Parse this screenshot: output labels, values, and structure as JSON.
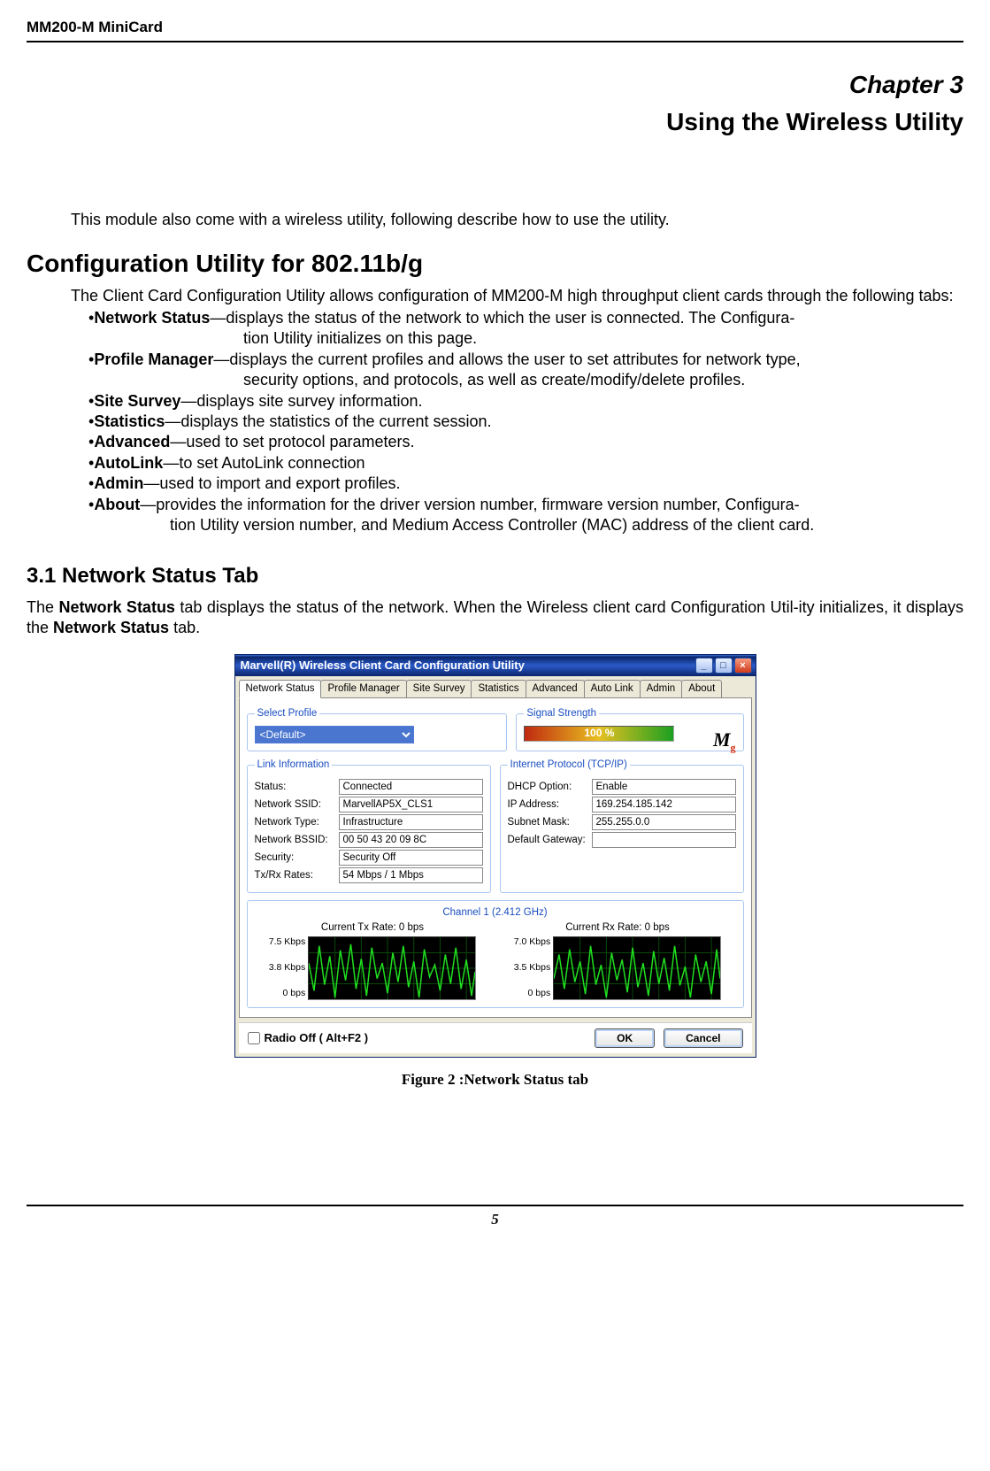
{
  "header": {
    "title": "MM200-M MiniCard"
  },
  "chapter": {
    "label": "Chapter 3",
    "subtitle": "Using the Wireless Utility"
  },
  "intro": "This module also come with a wireless utility, following describe how to use the utility.",
  "config": {
    "heading": "Configuration Utility for 802.11b/g",
    "lead": "The Client Card Configuration Utility allows configuration of MM200-M high throughput client cards through the following tabs:",
    "items": [
      {
        "name": "Network Status",
        "desc": "—displays the status of the network to which the user is connected. The Configura-",
        "wrap": "tion Utility initializes on this page."
      },
      {
        "name": "Profile Manager",
        "desc": "—displays the current profiles and allows the user to set attributes for network type,",
        "wrap": "security options, and protocols, as well as create/modify/delete profiles."
      },
      {
        "name": "Site Survey",
        "desc": "—displays site survey information."
      },
      {
        "name": "Statistics",
        "desc": "—displays the statistics of the current session."
      },
      {
        "name": "Advanced",
        "desc": "—used to set protocol parameters."
      },
      {
        "name": "AutoLink",
        "desc": "—to set AutoLink connection"
      },
      {
        "name": "Admin",
        "desc": "—used to import and export profiles."
      },
      {
        "name": "About",
        "desc": "—provides the information for the driver version number, firmware version number, Configura-",
        "wrap2": "tion Utility version number, and Medium Access Controller (MAC) address of the client card."
      }
    ]
  },
  "section31": {
    "heading": "3.1 Network Status Tab",
    "p1a": "The ",
    "p1b": "Network Status",
    "p1c": " tab displays the status of the network. When the Wireless client card Configuration Util-ity initializes, it displays the ",
    "p1d": "Network Status",
    "p1e": " tab."
  },
  "win": {
    "title": "Marvell(R) Wireless Client Card Configuration Utility",
    "tabs": [
      "Network Status",
      "Profile Manager",
      "Site Survey",
      "Statistics",
      "Advanced",
      "Auto Link",
      "Admin",
      "About"
    ],
    "select_profile": {
      "legend": "Select Profile",
      "value": "<Default>"
    },
    "signal": {
      "legend": "Signal Strength",
      "percent": "100 %"
    },
    "logo": {
      "text": "M",
      "sub": "g"
    },
    "link": {
      "legend": "Link Information",
      "rows": [
        {
          "label": "Status:",
          "value": "Connected"
        },
        {
          "label": "Network SSID:",
          "value": "MarvellAP5X_CLS1"
        },
        {
          "label": "Network Type:",
          "value": "Infrastructure"
        },
        {
          "label": "Network BSSID:",
          "value": "00 50 43 20 09 8C"
        },
        {
          "label": "Security:",
          "value": "Security Off"
        },
        {
          "label": "Tx/Rx Rates:",
          "value": "54 Mbps / 1 Mbps"
        }
      ]
    },
    "ip": {
      "legend": "Internet Protocol (TCP/IP)",
      "rows": [
        {
          "label": "DHCP Option:",
          "value": "Enable"
        },
        {
          "label": "IP Address:",
          "value": "169.254.185.142"
        },
        {
          "label": "Subnet Mask:",
          "value": "255.255.0.0"
        },
        {
          "label": "Default Gateway:",
          "value": ""
        }
      ]
    },
    "channel": "Channel 1 (2.412 GHz)",
    "tx": {
      "title": "Current Tx Rate: 0 bps",
      "ylabels": [
        "7.5 Kbps",
        "3.8 Kbps",
        "0 bps"
      ]
    },
    "rx": {
      "title": "Current Rx Rate: 0 bps",
      "ylabels": [
        "7.0 Kbps",
        "3.5 Kbps",
        "0 bps"
      ]
    },
    "radio_off": "Radio Off  ( Alt+F2 )",
    "ok": "OK",
    "cancel": "Cancel"
  },
  "figure_caption": "Figure 2 :Network Status tab",
  "page_number": "5"
}
